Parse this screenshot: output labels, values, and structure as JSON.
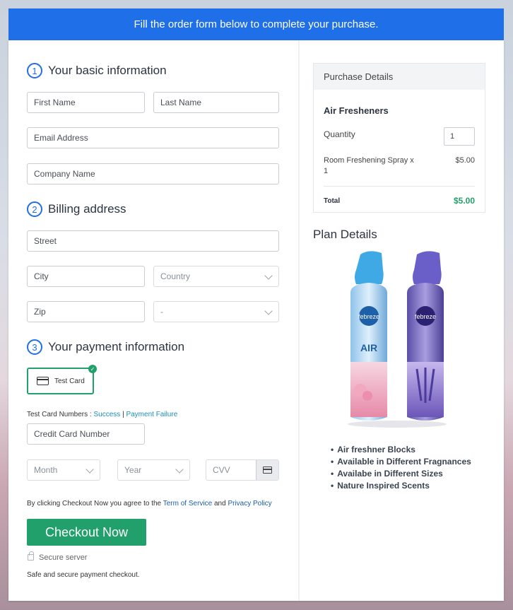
{
  "banner": "Fill the order form below to complete your purchase.",
  "sections": {
    "basic": {
      "num": "1",
      "title": "Your basic information"
    },
    "billing": {
      "num": "2",
      "title": "Billing address"
    },
    "payment": {
      "num": "3",
      "title": "Your payment information"
    }
  },
  "fields": {
    "first_name": "First Name",
    "last_name": "Last Name",
    "email": "Email Address",
    "company": "Company Name",
    "street": "Street",
    "city": "City",
    "country": "Country",
    "zip": "Zip",
    "state": "-",
    "card_number": "Credit Card Number",
    "month": "Month",
    "year": "Year",
    "cvv": "CVV"
  },
  "payment": {
    "test_card_label": "Test Card",
    "test_numbers_label": "Test Card Numbers :",
    "success_link": "Success",
    "separator": "|",
    "failure_link": "Payment Failure"
  },
  "agreement": {
    "prefix": "By clicking Checkout Now you agree to the",
    "terms_link": "Term of Service",
    "and": "and",
    "privacy_link": "Privacy Policy"
  },
  "checkout_button": "Checkout Now",
  "secure_server": "Secure server",
  "secure_note": "Safe and secure payment checkout.",
  "purchase": {
    "header": "Purchase Details",
    "product": "Air Fresheners",
    "quantity_label": "Quantity",
    "quantity_value": "1",
    "item_line1": "Room Freshening Spray x",
    "item_line2": "1",
    "item_price": "$5.00",
    "total_label": "Total",
    "total_value": "$5.00"
  },
  "plan": {
    "title": "Plan Details",
    "features": [
      "Air freshner Blocks",
      "Available in Different Fragnances",
      "Availabe in Different Sizes",
      "Nature Inspired Scents"
    ]
  },
  "colors": {
    "accent": "#1f6fe8",
    "success": "#22a06b",
    "total": "#22a06b"
  }
}
